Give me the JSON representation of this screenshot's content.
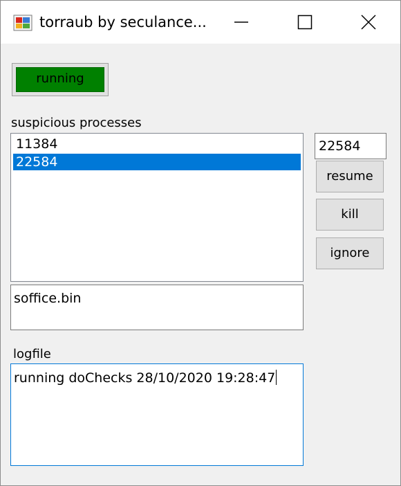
{
  "window": {
    "title": "torraub by seculance...",
    "icon": "app-icon"
  },
  "titlebar_buttons": {
    "minimize": "minimize-icon",
    "maximize": "maximize-icon",
    "close": "close-icon"
  },
  "status": {
    "label": "running",
    "color": "#008000"
  },
  "suspicious": {
    "label": "suspicious processes",
    "items": [
      "11384",
      "22584"
    ],
    "selected_index": 1,
    "selection_color": "#0078d7"
  },
  "pid_field": {
    "value": "22584"
  },
  "actions": {
    "resume": "resume",
    "kill": "kill",
    "ignore": "ignore"
  },
  "process_name": {
    "value": "soffice.bin"
  },
  "log": {
    "label": "logfile",
    "text": "running doChecks 28/10/2020 19:28:47"
  }
}
